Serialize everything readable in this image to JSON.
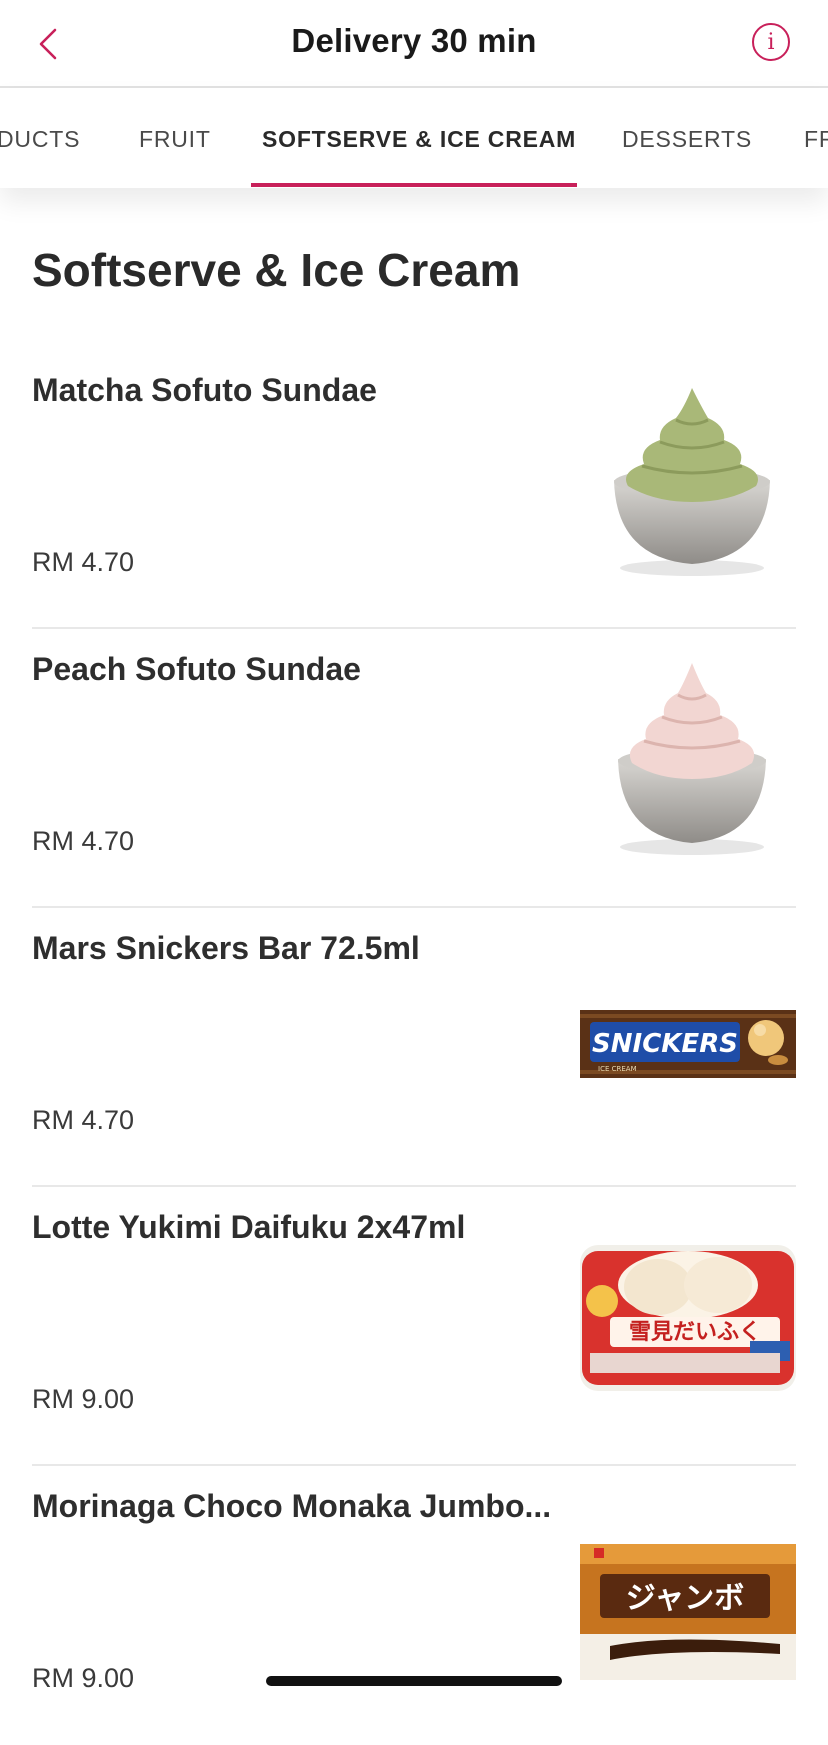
{
  "header": {
    "title": "Delivery 30 min",
    "info_label": "i",
    "accent_color": "#c8205a"
  },
  "tabs": [
    {
      "label": "DUCTS",
      "active": false
    },
    {
      "label": "FRUIT",
      "active": false
    },
    {
      "label": "SOFTSERVE & ICE CREAM",
      "active": true
    },
    {
      "label": "DESSERTS",
      "active": false
    },
    {
      "label": "FR",
      "active": false
    }
  ],
  "section": {
    "title": "Softserve & Ice Cream"
  },
  "items": [
    {
      "name": "Matcha Sofuto Sundae",
      "price": "RM 4.70",
      "image": "matcha-softserve-image"
    },
    {
      "name": "Peach Sofuto Sundae",
      "price": "RM 4.70",
      "image": "peach-softserve-image"
    },
    {
      "name": "Mars Snickers Bar 72.5ml",
      "price": "RM 4.70",
      "image": "snickers-bar-image",
      "image_text": "SNICKERS",
      "image_subtext": "ICE CREAM"
    },
    {
      "name": "Lotte Yukimi Daifuku 2x47ml",
      "price": "RM 9.00",
      "image": "yukimi-daifuku-image",
      "image_text": "雪見だいふく"
    },
    {
      "name": "Morinaga Choco Monaka Jumbo...",
      "price": "RM 9.00",
      "image": "choco-monaka-image",
      "image_text": "ジャンボ"
    }
  ]
}
